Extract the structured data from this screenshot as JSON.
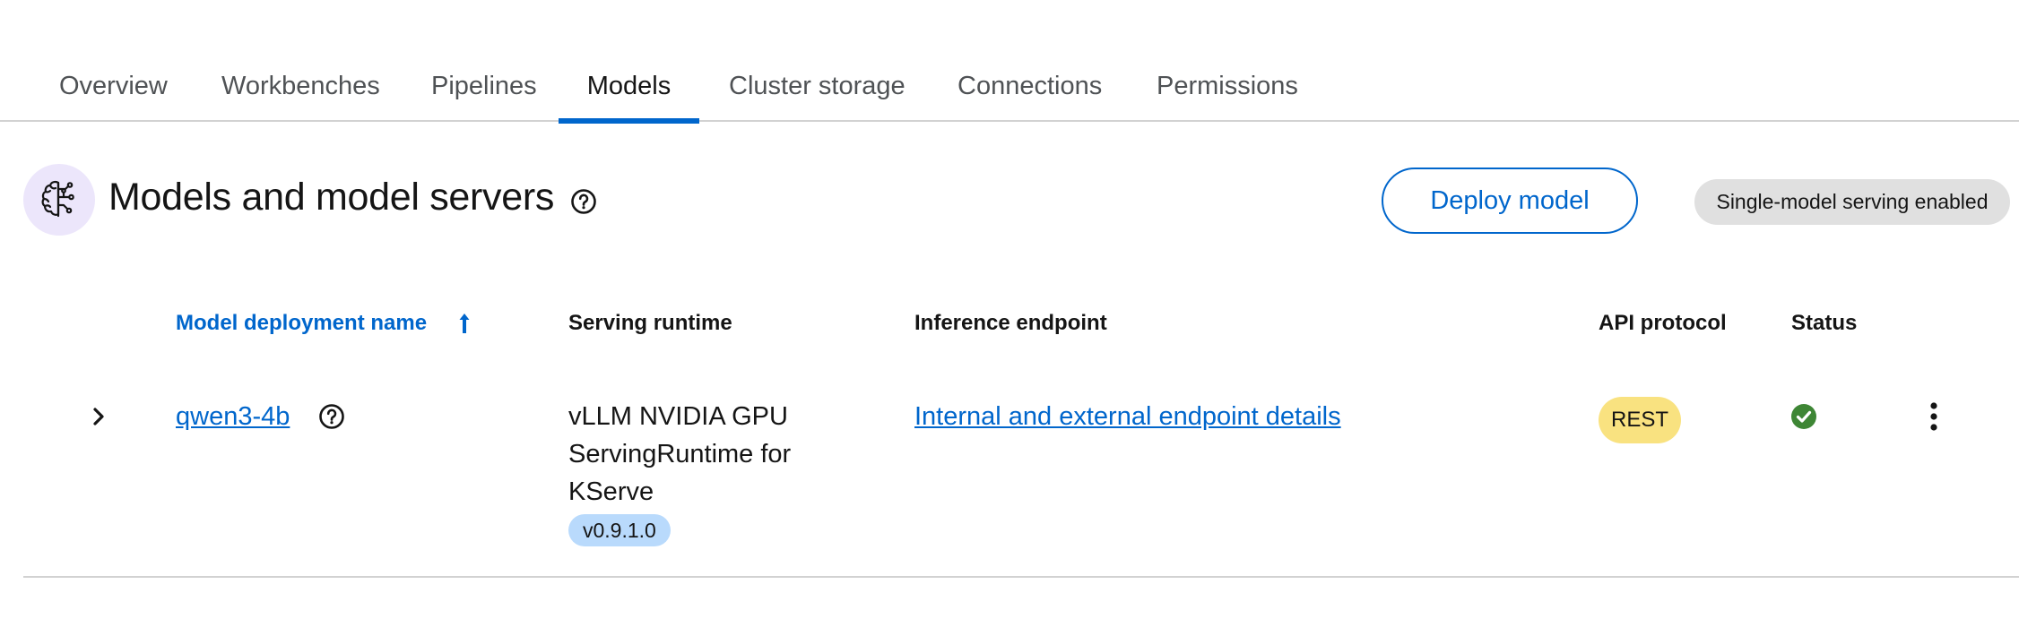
{
  "tabs": [
    {
      "label": "Overview",
      "active": false
    },
    {
      "label": "Workbenches",
      "active": false
    },
    {
      "label": "Pipelines",
      "active": false
    },
    {
      "label": "Models",
      "active": true
    },
    {
      "label": "Cluster storage",
      "active": false
    },
    {
      "label": "Connections",
      "active": false
    },
    {
      "label": "Permissions",
      "active": false
    }
  ],
  "header": {
    "icon": "brain-circuit-icon",
    "title": "Models and model servers",
    "help_icon": "question-circle-icon",
    "deploy_button": "Deploy model",
    "serving_badge": "Single-model serving enabled"
  },
  "table": {
    "columns": [
      {
        "label": "Model deployment name",
        "sortable": true,
        "sort_direction": "ascending"
      },
      {
        "label": "Serving runtime"
      },
      {
        "label": "Inference endpoint"
      },
      {
        "label": "API protocol"
      },
      {
        "label": "Status"
      }
    ],
    "rows": [
      {
        "name": "qwen3-4b",
        "runtime": "vLLM NVIDIA GPU ServingRuntime for KServe",
        "runtime_version": "v0.9.1.0",
        "endpoint": "Internal and external endpoint details",
        "api_protocol": "REST",
        "status": "success",
        "status_icon": "check-circle-icon",
        "actions_icon": "kebab-menu-icon",
        "expand_icon": "chevron-right-icon"
      }
    ]
  },
  "colors": {
    "accent": "#0066cc",
    "status_success": "#3e8635",
    "rest_badge": "#f9e280",
    "version_badge": "#b9dafc",
    "icon_bg": "#ece6fb"
  }
}
